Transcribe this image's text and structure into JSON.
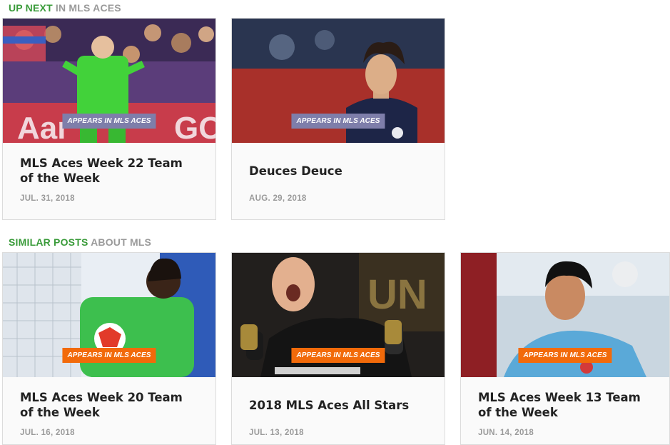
{
  "up_next": {
    "accent": "UP NEXT",
    "rest": "IN MLS ACES",
    "cards": [
      {
        "badge": "APPEARS IN MLS ACES",
        "badge_color": "#7e7eaa",
        "title": "MLS Aces Week 22 Team of the Week",
        "date": "JUL. 31, 2018"
      },
      {
        "badge": "APPEARS IN MLS ACES",
        "badge_color": "#7e7eaa",
        "title": "Deuces Deuce",
        "date": "AUG. 29, 2018"
      }
    ]
  },
  "similar": {
    "accent": "SIMILAR POSTS",
    "rest": "ABOUT MLS",
    "cards": [
      {
        "badge": "APPEARS IN MLS ACES",
        "badge_color": "#f26a0a",
        "title": "MLS Aces Week 20 Team of the Week",
        "date": "JUL. 16, 2018"
      },
      {
        "badge": "APPEARS IN MLS ACES",
        "badge_color": "#f26a0a",
        "title": "2018 MLS Aces All Stars",
        "date": "JUL. 13, 2018"
      },
      {
        "badge": "APPEARS IN MLS ACES",
        "badge_color": "#f26a0a",
        "title": "MLS Aces Week 13 Team of the Week",
        "date": "JUN. 14, 2018"
      }
    ]
  },
  "colors": {
    "accent_green": "#3a9b3a",
    "muted_gray": "#9a9a9a"
  }
}
